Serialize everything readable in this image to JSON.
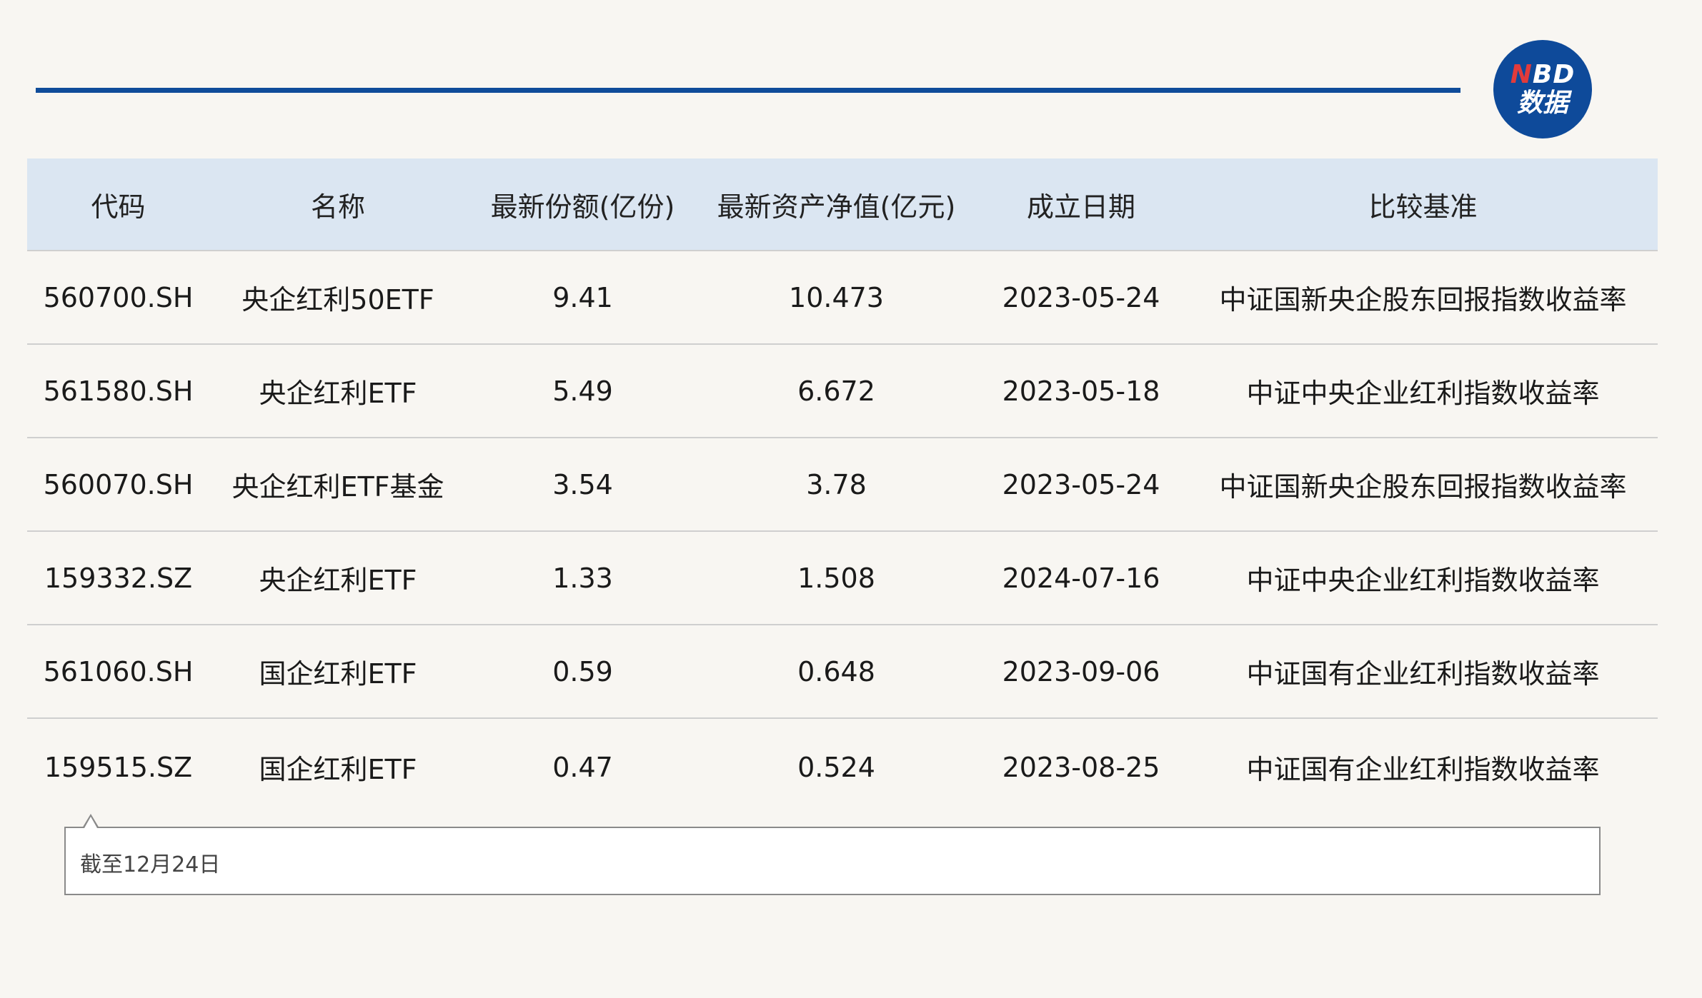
{
  "brand": {
    "logo_line1_first": "N",
    "logo_line1_rest": "BD",
    "logo_line2": "数据",
    "accent_color": "#0f4c9a",
    "header_bg": "#dbe6f2"
  },
  "table": {
    "headers": [
      "代码",
      "名称",
      "最新份额(亿份)",
      "最新资产净值(亿元)",
      "成立日期",
      "比较基准"
    ],
    "rows": [
      [
        "560700.SH",
        "央企红利50ETF",
        "9.41",
        "10.473",
        "2023-05-24",
        "中证国新央企股东回报指数收益率"
      ],
      [
        "561580.SH",
        "央企红利ETF",
        "5.49",
        "6.672",
        "2023-05-18",
        "中证中央企业红利指数收益率"
      ],
      [
        "560070.SH",
        "央企红利ETF基金",
        "3.54",
        "3.78",
        "2023-05-24",
        "中证国新央企股东回报指数收益率"
      ],
      [
        "159332.SZ",
        "央企红利ETF",
        "1.33",
        "1.508",
        "2024-07-16",
        "中证中央企业红利指数收益率"
      ],
      [
        "561060.SH",
        "国企红利ETF",
        "0.59",
        "0.648",
        "2023-09-06",
        "中证国有企业红利指数收益率"
      ],
      [
        "159515.SZ",
        "国企红利ETF",
        "0.47",
        "0.524",
        "2023-08-25",
        "中证国有企业红利指数收益率"
      ]
    ]
  },
  "note": {
    "text": "截至12月24日"
  }
}
